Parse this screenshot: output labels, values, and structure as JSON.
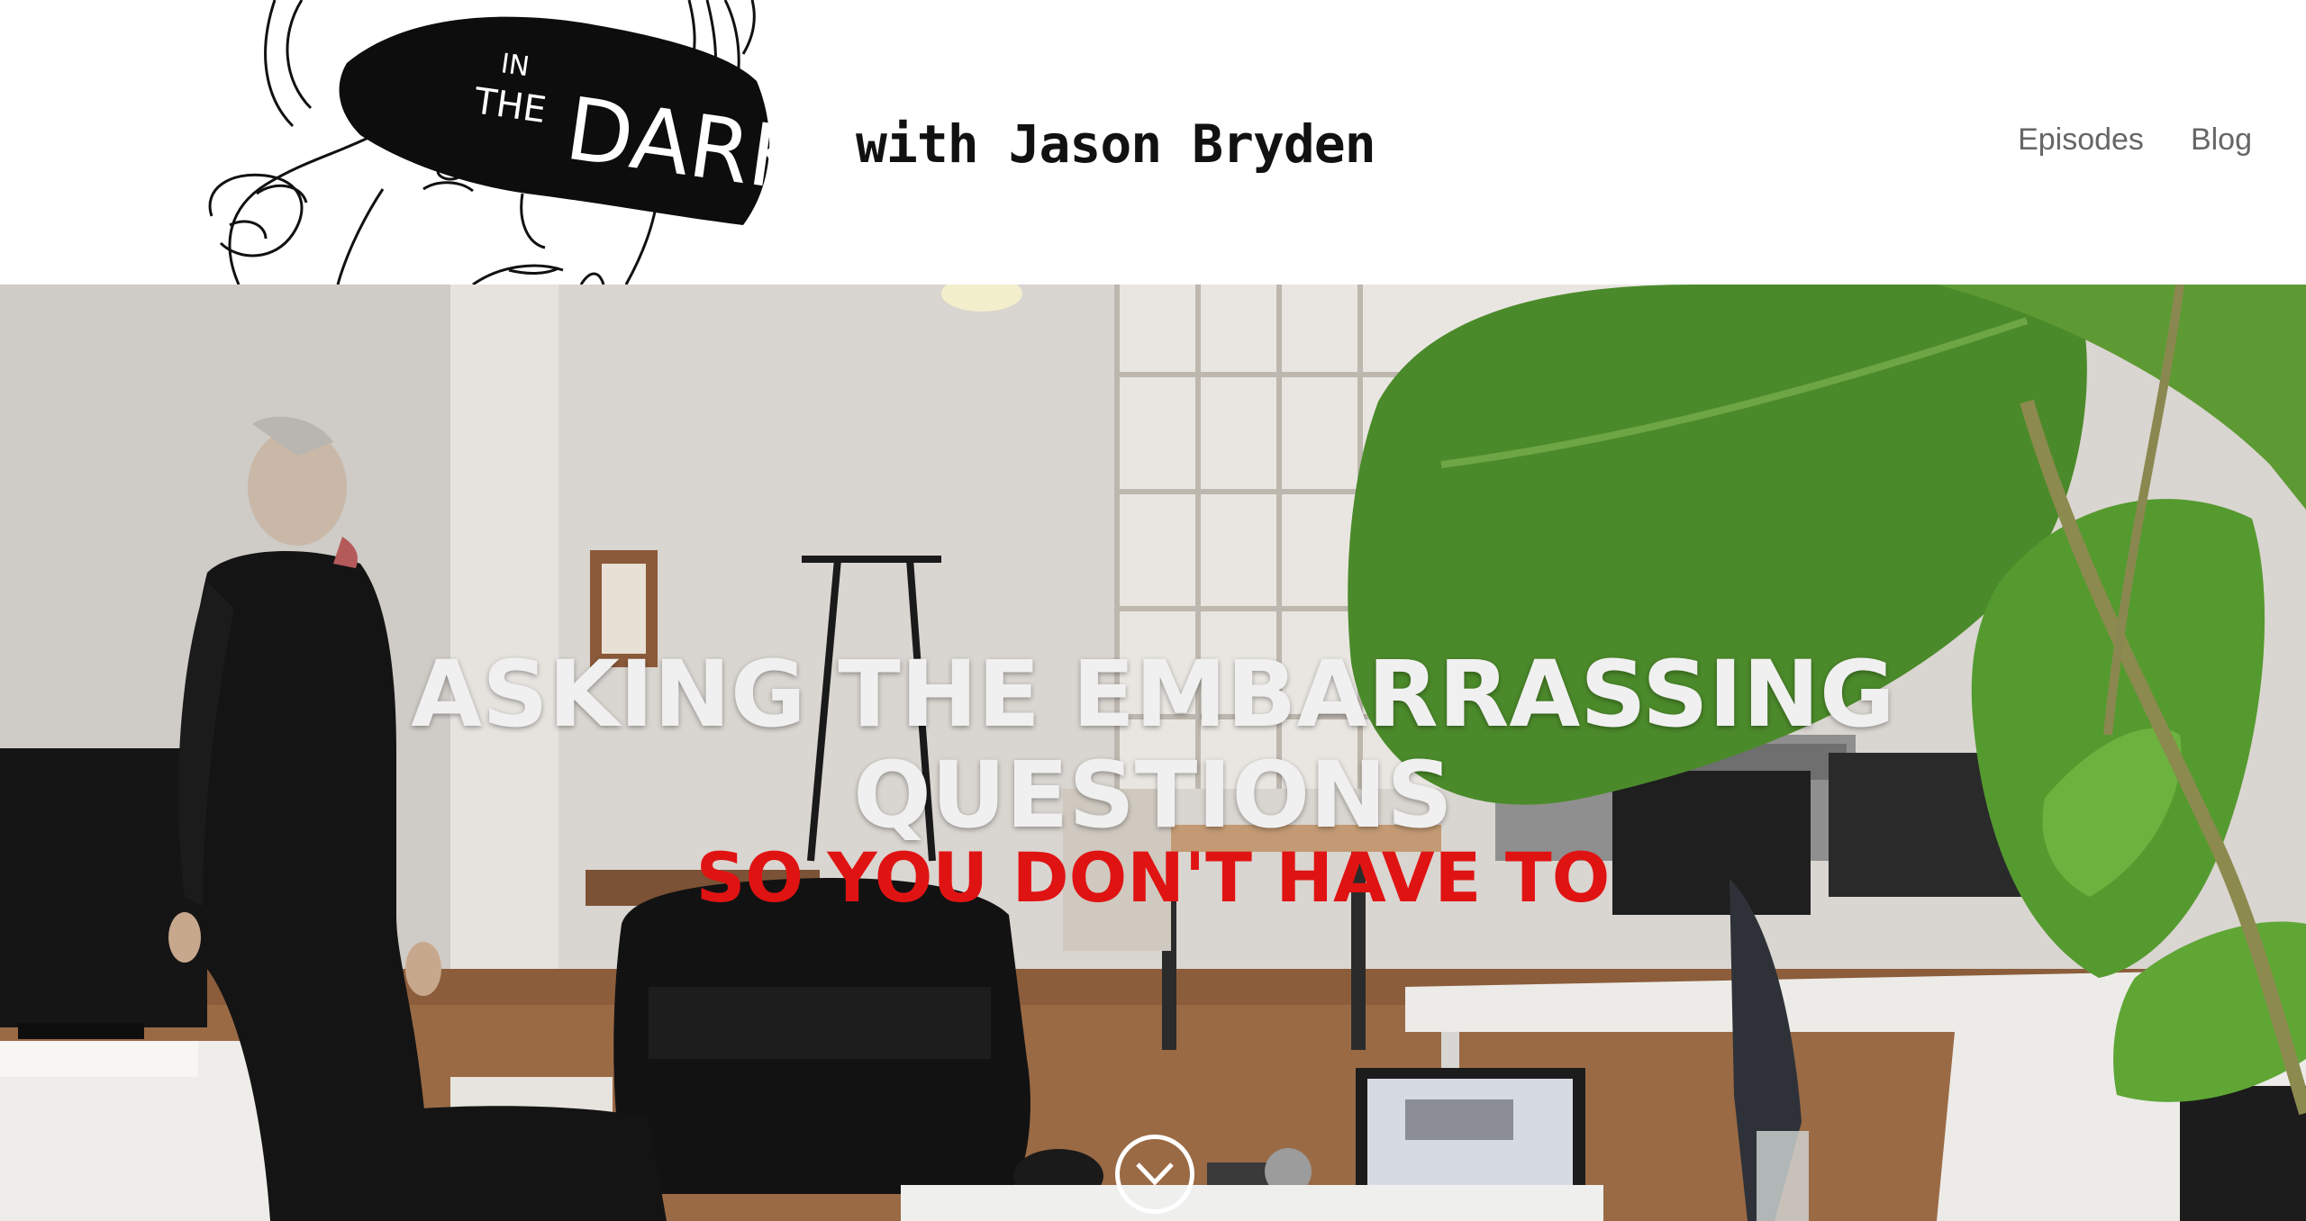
{
  "header": {
    "logo": {
      "text_top": "IN",
      "text_mid": "THE",
      "text_big": "DARK"
    },
    "tagline": "with Jason Bryden",
    "nav": [
      {
        "label": "Episodes"
      },
      {
        "label": "Blog"
      }
    ]
  },
  "hero": {
    "headline_line1": "ASKING THE EMBARRASSING",
    "headline_line2": "QUESTIONS",
    "subline": "SO YOU DON'T HAVE TO",
    "scroll_icon": "chevron-down-icon"
  },
  "colors": {
    "accent_red": "#e01313",
    "nav_gray": "#666666",
    "headline_white": "#f0f0f0"
  }
}
